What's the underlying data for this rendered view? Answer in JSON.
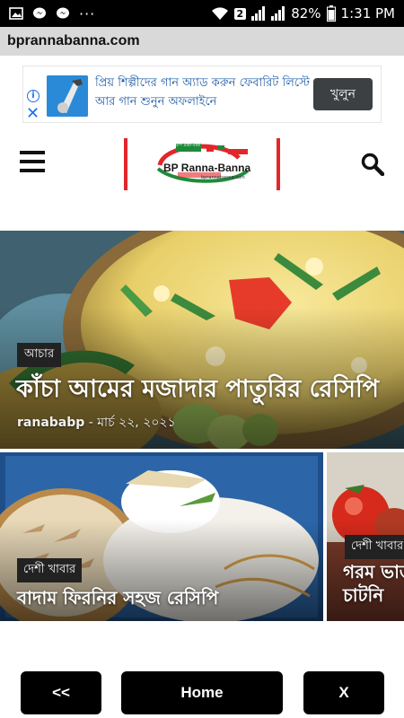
{
  "status_bar": {
    "battery": "82%",
    "time": "1:31 PM",
    "sim_badge": "2",
    "more": "···"
  },
  "browser": {
    "url": "bprannabanna.com"
  },
  "ad": {
    "text": "প্রিয় শিল্পীদের গান অ্যাড করুন ফেবারিট লিস্টে আর গান শুনুন অফলাইনে",
    "button": "খুলুন",
    "info_glyph": "i",
    "close_glyph": "✕"
  },
  "header": {
    "logo_text": "BP Ranna-Banna",
    "logo_tag": "বিপি রান্না-বান্না",
    "logo_url": "bprannabanna.com"
  },
  "hero": {
    "category": "আচার",
    "title": "কাঁচা আমের মজাদার পাতুরির রেসিপি",
    "author": "ranababp",
    "separator": "-",
    "date": "মার্চ ২২, ২০২১"
  },
  "cards": [
    {
      "category": "দেশী খাবার",
      "title": "বাদাম ফিরনির সহজ রেসিপি"
    },
    {
      "category": "দেশী খাবার",
      "title": "গরম ভাত চাটনি"
    }
  ],
  "bottom_nav": {
    "back": "<<",
    "home": "Home",
    "close": "X"
  },
  "colors": {
    "accent_red": "#e3262b",
    "ad_button": "#3c4043",
    "ad_text": "#1a5aa5"
  }
}
